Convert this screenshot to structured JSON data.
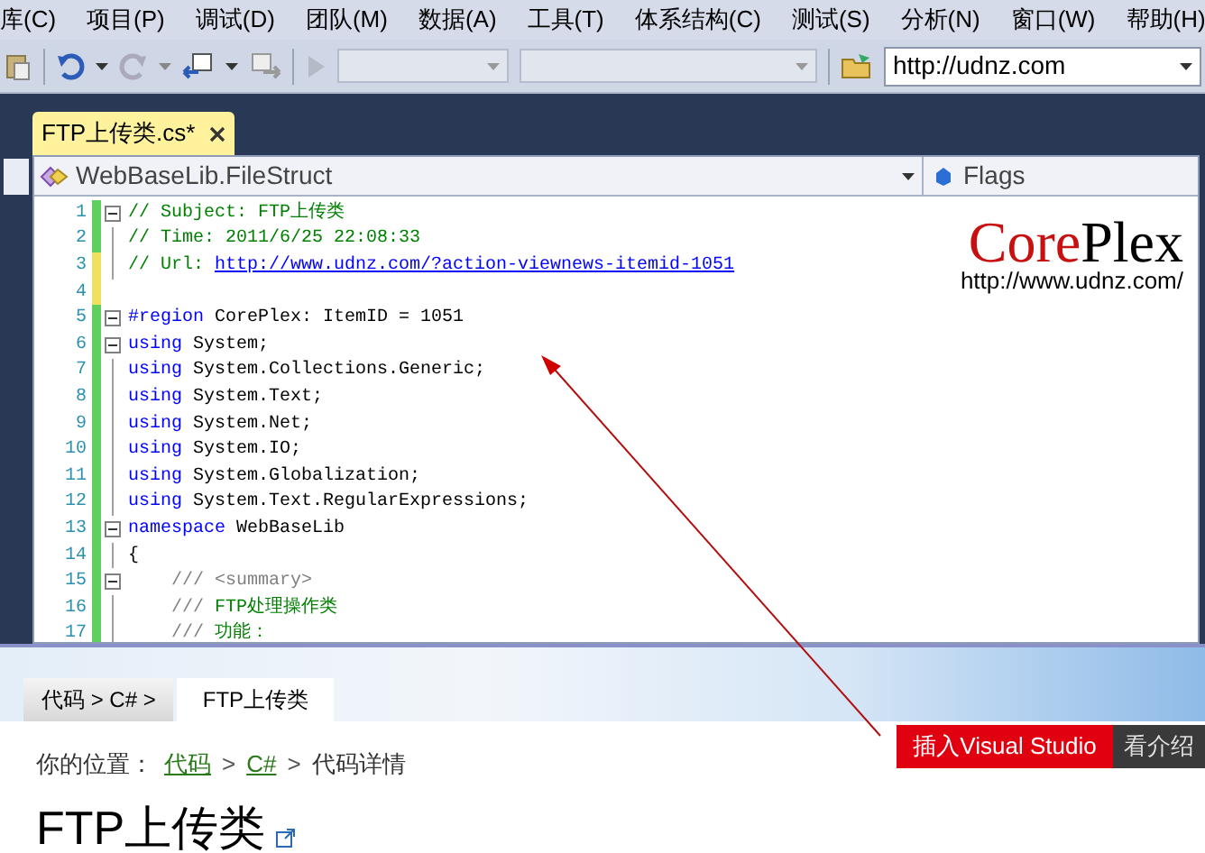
{
  "menu": [
    "库(C)",
    "项目(P)",
    "调试(D)",
    "团队(M)",
    "数据(A)",
    "工具(T)",
    "体系结构(C)",
    "测试(S)",
    "分析(N)",
    "窗口(W)",
    "帮助(H)"
  ],
  "toolbar": {
    "address": "http://udnz.com"
  },
  "tabs": [
    {
      "label": "FTP上传类.cs*",
      "selected": true
    }
  ],
  "navigation": {
    "type": "WebBaseLib.FileStruct",
    "member": "Flags"
  },
  "code_lines": [
    {
      "number": "1",
      "saved": true,
      "collapse": true,
      "segments": [
        {
          "text": "// Subject: FTP上传类",
          "kind": "comment"
        }
      ]
    },
    {
      "number": "2",
      "saved": true,
      "collapse": false,
      "segments": [
        {
          "text": "// Time: 2011/6/25 22:08:33",
          "kind": "comment"
        }
      ]
    },
    {
      "number": "3",
      "saved": false,
      "collapse": false,
      "segments": [
        {
          "text": "// Url: ",
          "kind": "comment"
        },
        {
          "text": "http://www.udnz.com/?action-viewnews-itemid-1051",
          "kind": "link"
        }
      ]
    },
    {
      "number": "4",
      "saved": false,
      "collapse": false
    },
    {
      "number": "5",
      "saved": true,
      "collapse": true,
      "segments": [
        {
          "text": "#region",
          "kind": "keyword"
        },
        {
          "text": " CorePlex: ItemID = 1051",
          "kind": "plain"
        }
      ]
    },
    {
      "number": "6",
      "saved": true,
      "collapse": true,
      "segments": [
        {
          "text": "using",
          "kind": "keyword"
        },
        {
          "text": " System;",
          "kind": "plain"
        }
      ]
    },
    {
      "number": "7",
      "saved": true,
      "collapse": false,
      "segments": [
        {
          "text": "using",
          "kind": "keyword"
        },
        {
          "text": " System.Collections.Generic;",
          "kind": "plain"
        }
      ]
    },
    {
      "number": "8",
      "saved": true,
      "collapse": false,
      "segments": [
        {
          "text": "using",
          "kind": "keyword"
        },
        {
          "text": " System.Text;",
          "kind": "plain"
        }
      ]
    },
    {
      "number": "9",
      "saved": true,
      "collapse": false,
      "segments": [
        {
          "text": "using",
          "kind": "keyword"
        },
        {
          "text": " System.Net;",
          "kind": "plain"
        }
      ]
    },
    {
      "number": "10",
      "saved": true,
      "collapse": false,
      "segments": [
        {
          "text": "using",
          "kind": "keyword"
        },
        {
          "text": " System.IO;",
          "kind": "plain"
        }
      ]
    },
    {
      "number": "11",
      "saved": true,
      "collapse": false,
      "segments": [
        {
          "text": "using",
          "kind": "keyword"
        },
        {
          "text": " System.Globalization;",
          "kind": "plain"
        }
      ]
    },
    {
      "number": "12",
      "saved": true,
      "collapse": false,
      "segments": [
        {
          "text": "using",
          "kind": "keyword"
        },
        {
          "text": " System.Text.RegularExpressions;",
          "kind": "plain"
        }
      ]
    },
    {
      "number": "13",
      "saved": true,
      "collapse": true,
      "segments": [
        {
          "text": "namespace",
          "kind": "keyword"
        },
        {
          "text": " WebBaseLib",
          "kind": "plain"
        }
      ]
    },
    {
      "number": "14",
      "saved": true,
      "collapse": false,
      "segments": [
        {
          "text": "{",
          "kind": "plain"
        }
      ]
    },
    {
      "number": "15",
      "saved": true,
      "collapse": true,
      "segments": [
        {
          "text": "    /// <summary>",
          "kind": "doc"
        }
      ]
    },
    {
      "number": "16",
      "saved": true,
      "collapse": false,
      "segments": [
        {
          "text": "    ///",
          "kind": "doc"
        },
        {
          "text": " FTP处理操作类",
          "kind": "comment"
        }
      ]
    },
    {
      "number": "17",
      "saved": true,
      "collapse": false,
      "segments": [
        {
          "text": "    ///",
          "kind": "doc"
        },
        {
          "text": " 功能：",
          "kind": "comment"
        }
      ]
    }
  ],
  "logo": {
    "parts": [
      "Core",
      "Plex"
    ],
    "url": "http://www.udnz.com/"
  },
  "web_page": {
    "tabs": [
      {
        "label": "代码 > C# >",
        "selected": false
      },
      {
        "label": "FTP上传类",
        "selected": true
      }
    ],
    "breadcrumb": [
      {
        "text": "你的位置：",
        "kind": "label"
      },
      {
        "text": "代码",
        "kind": "link"
      },
      {
        "text": ">",
        "kind": "separator"
      },
      {
        "text": "C#",
        "kind": "link"
      },
      {
        "text": ">",
        "kind": "separator"
      },
      {
        "text": "代码详情",
        "kind": "current"
      }
    ],
    "title": "FTP上传类",
    "buttons": [
      {
        "label": "插入Visual Studio",
        "kind": "primary"
      },
      {
        "label": "看介绍",
        "kind": "secondary"
      }
    ]
  }
}
